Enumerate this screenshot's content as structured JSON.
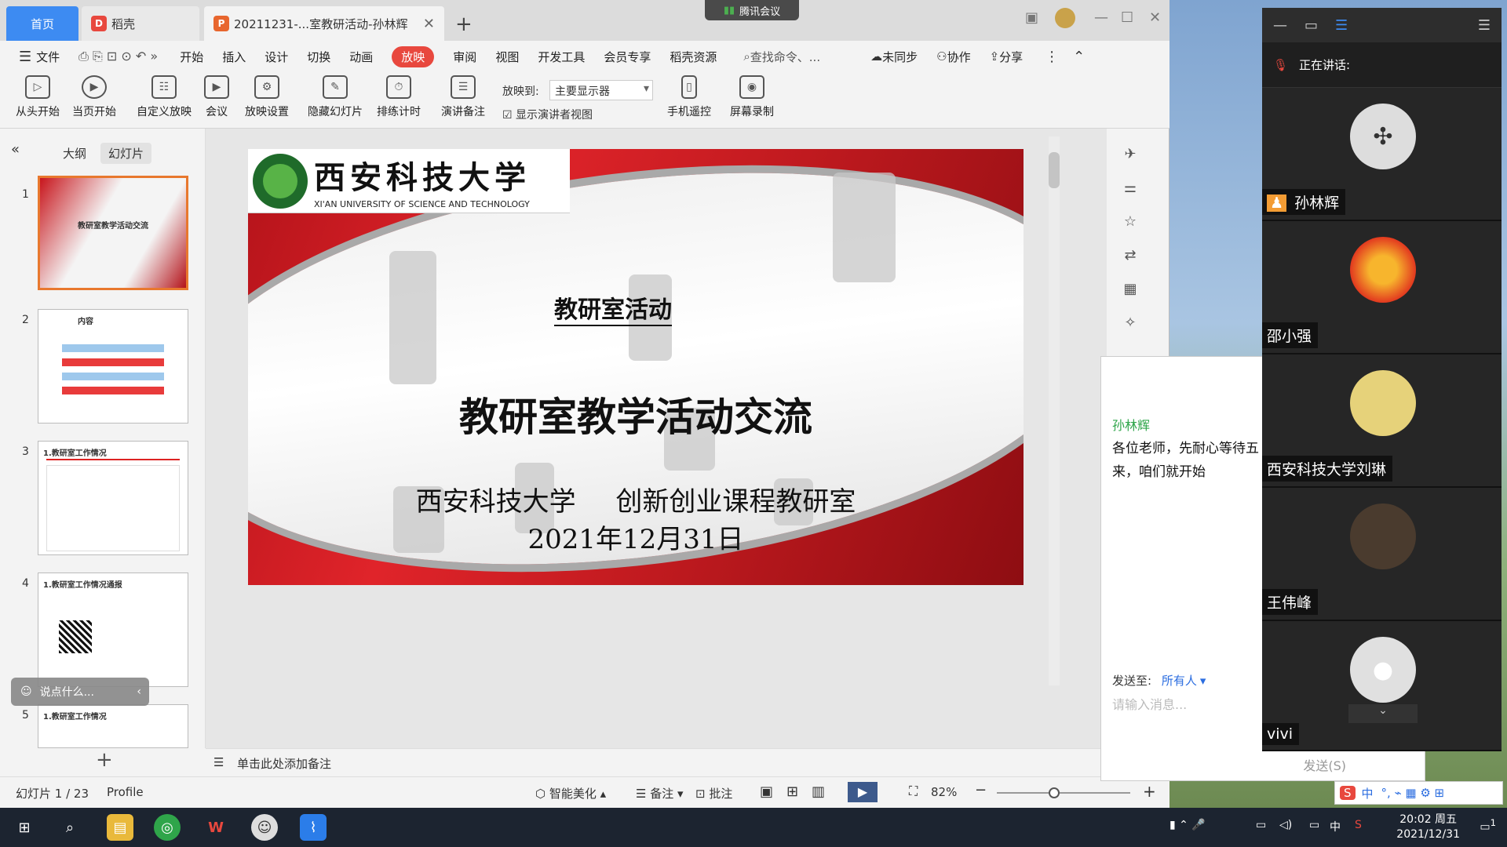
{
  "tabs": {
    "home": "首页",
    "daoke": "稻壳",
    "doc": "20211231-...室教研活动-孙林辉",
    "new_tab": "+"
  },
  "meeting_pill": "腾讯会议",
  "menu": {
    "file": "文件",
    "items": [
      "开始",
      "插入",
      "设计",
      "切换",
      "动画",
      "放映",
      "审阅",
      "视图",
      "开发工具",
      "会员专享",
      "稻壳资源"
    ],
    "search": "查找命令、...",
    "unsynced": "未同步",
    "collab": "协作",
    "share": "分享"
  },
  "ribbon": {
    "buttons": [
      "从头开始",
      "当页开始",
      "自定义放映",
      "会议",
      "放映设置",
      "隐藏幻灯片",
      "排练计时",
      "演讲备注",
      "手机遥控",
      "屏幕录制"
    ],
    "play_to_label": "放映到:",
    "display_value": "主要显示器",
    "presenter_view": "显示演讲者视图"
  },
  "left_panel": {
    "tab_outline": "大纲",
    "tab_slides": "幻灯片",
    "chat_placeholder": "说点什么...",
    "add": "+",
    "thumbs": [
      {
        "num": "1",
        "title": "教研室教学活动交流"
      },
      {
        "num": "2",
        "title": "内容"
      },
      {
        "num": "3",
        "title": "1.教研室工作情况"
      },
      {
        "num": "4",
        "title": "1.教研室工作情况通报"
      },
      {
        "num": "5",
        "title": "1.教研室工作情况"
      }
    ]
  },
  "slide": {
    "logo_cn": "西安科技大学",
    "logo_en": "XI'AN UNIVERSITY OF SCIENCE AND TECHNOLOGY",
    "subtitle": "教研室活动",
    "title": "教研室教学活动交流",
    "org": "西安科技大学 创新创业课程教研室",
    "date": "2021年12月31日"
  },
  "notes_placeholder": "单击此处添加备注",
  "status": {
    "slide_count": "幻灯片 1 / 23",
    "profile": "Profile",
    "beautify": "智能美化",
    "notes": "备注",
    "comments": "批注",
    "zoom": "82%"
  },
  "chat": {
    "sender": "孙林辉",
    "message": "各位老师，先耐心等待五来，咱们就开始",
    "send_to_label": "发送至:",
    "send_to_value": "所有人",
    "input_placeholder": "请输入消息...",
    "send_button": "发送(S)"
  },
  "meeting": {
    "speaking": "正在讲话:",
    "participants": [
      "孙林辉",
      "邵小强",
      "西安科技大学刘琳",
      "王伟峰",
      "vivi"
    ]
  },
  "taskbar": {
    "time": "20:02 周五",
    "date": "2021/12/31",
    "ime": "中",
    "notif_count": "1"
  },
  "colors": {
    "accent_red": "#e8483e",
    "home_tab_blue": "#3d8bf2",
    "chat_sender_green": "#2fa54a"
  }
}
